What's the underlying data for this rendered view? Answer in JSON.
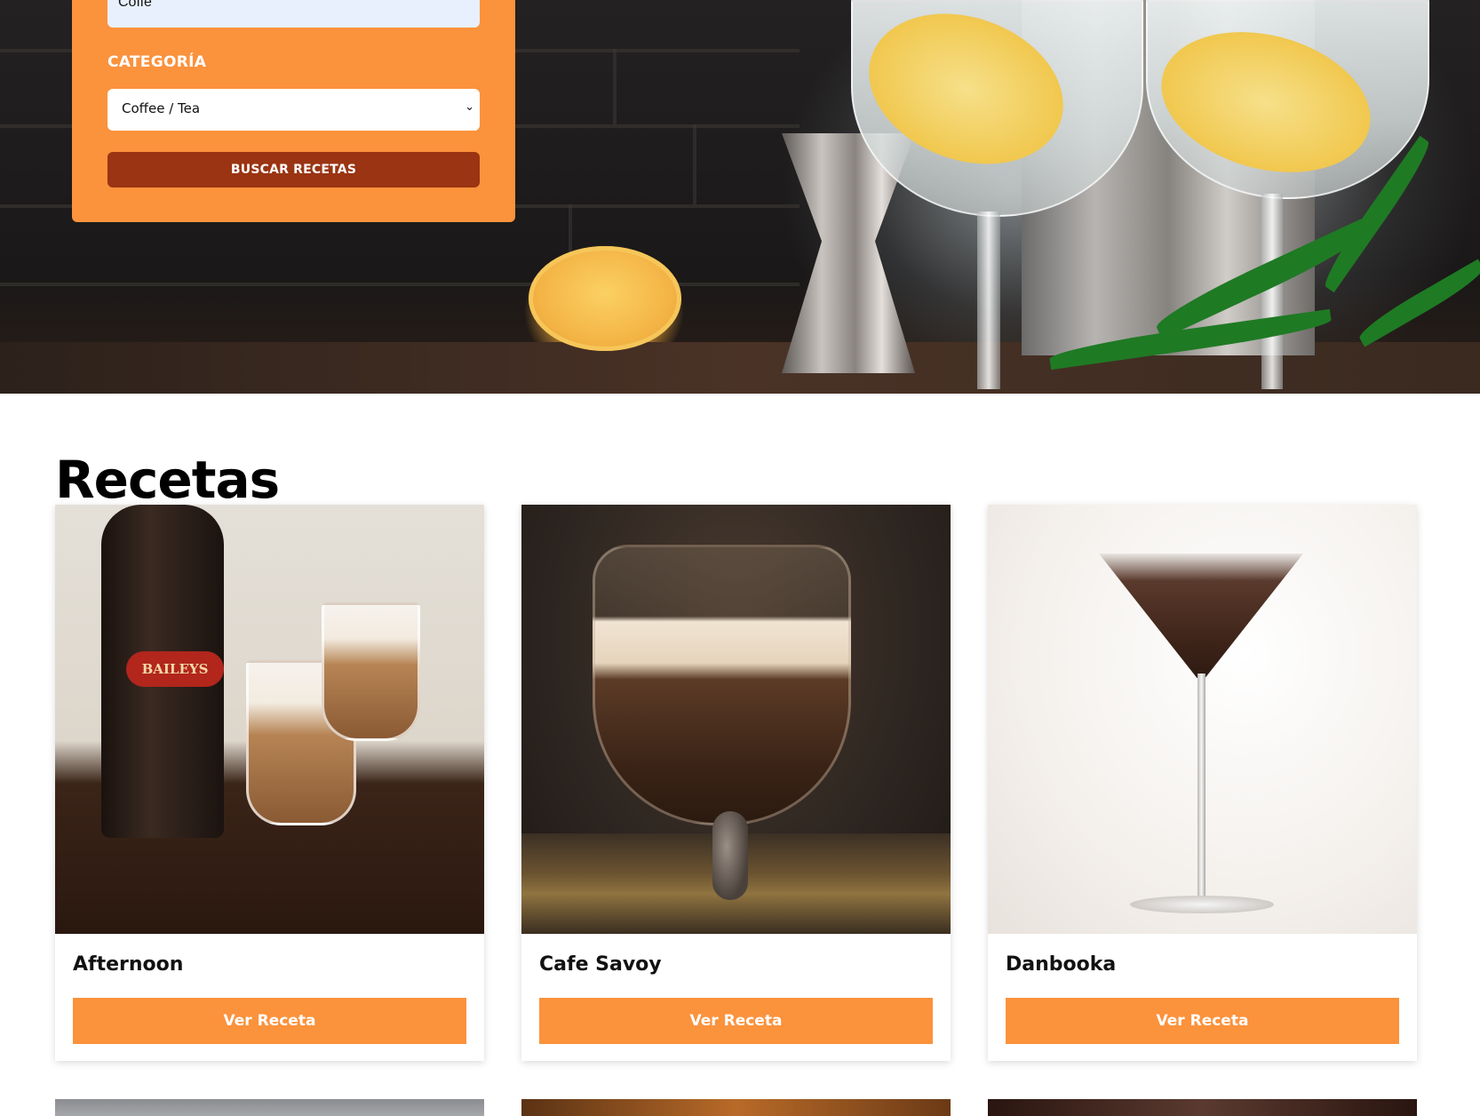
{
  "search": {
    "ingredient_value": "Coffe",
    "category_label": "CATEGORÍA",
    "category_selected": "Coffee / Tea",
    "submit_label": "BUSCAR RECETAS"
  },
  "recipes": {
    "title": "Recetas",
    "items": [
      {
        "name": "Afternoon",
        "button": "Ver Receta"
      },
      {
        "name": "Cafe Savoy",
        "button": "Ver Receta"
      },
      {
        "name": "Danbooka",
        "button": "Ver Receta"
      }
    ]
  },
  "colors": {
    "accent": "#fb923c",
    "search_button": "#9a3412",
    "input_bg": "#e8f0fe"
  },
  "icons": {
    "select_chevron": "chevron-down-icon"
  }
}
